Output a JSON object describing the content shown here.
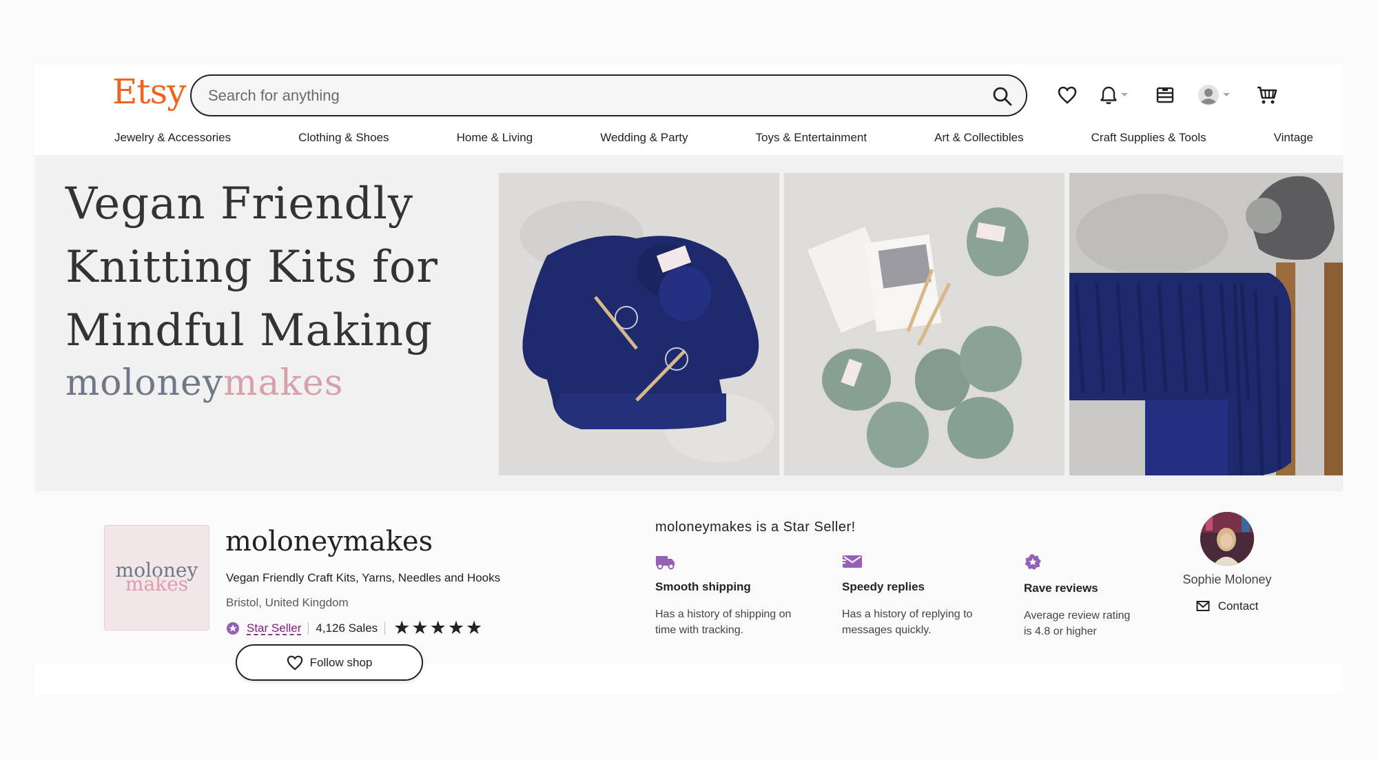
{
  "header": {
    "logo": "Etsy",
    "search_placeholder": "Search for anything",
    "icons": [
      "search-icon",
      "heart-icon",
      "bell-icon",
      "gift-shop-icon",
      "account-icon",
      "cart-icon"
    ]
  },
  "categories": [
    "Jewelry & Accessories",
    "Clothing & Shoes",
    "Home & Living",
    "Wedding & Party",
    "Toys & Entertainment",
    "Art & Collectibles",
    "Craft Supplies & Tools",
    "Vintage"
  ],
  "banner": {
    "headline_line1": "Vegan Friendly",
    "headline_line2": "Knitting Kits for",
    "headline_line3": "Mindful Making",
    "brand_part1": "moloney",
    "brand_part2": "makes"
  },
  "shop": {
    "logo_line1": "moloney",
    "logo_line2": "makes",
    "name": "moloneymakes",
    "tagline": "Vegan Friendly Craft Kits, Yarns, Needles and Hooks",
    "location": "Bristol, United Kingdom",
    "star_seller_label": "Star Seller",
    "sales": "4,126 Sales",
    "rating_stars": 5,
    "follow_label": "Follow shop"
  },
  "star_seller": {
    "title": "moloneymakes is a Star Seller!",
    "perks": [
      {
        "icon": "truck-icon",
        "title": "Smooth shipping",
        "desc_line1": "Has a history of shipping on",
        "desc_line2": "time with tracking."
      },
      {
        "icon": "message-icon",
        "title": "Speedy replies",
        "desc_line1": "Has a history of replying to",
        "desc_line2": "messages quickly."
      },
      {
        "icon": "star-badge-icon",
        "title": "Rave reviews",
        "desc_line1": "Average review rating",
        "desc_line2": "is 4.8 or higher"
      }
    ]
  },
  "owner": {
    "name": "Sophie Moloney",
    "contact_label": "Contact"
  },
  "colors": {
    "etsy_orange": "#f1641e",
    "star_seller_purple": "#7f187f",
    "perk_icon_purple": "#9560b8",
    "brand_slate": "#6e7888",
    "brand_pink": "#d9a0ac",
    "yarn_navy": "#1f2a6e",
    "yarn_sage": "#8aa396"
  }
}
